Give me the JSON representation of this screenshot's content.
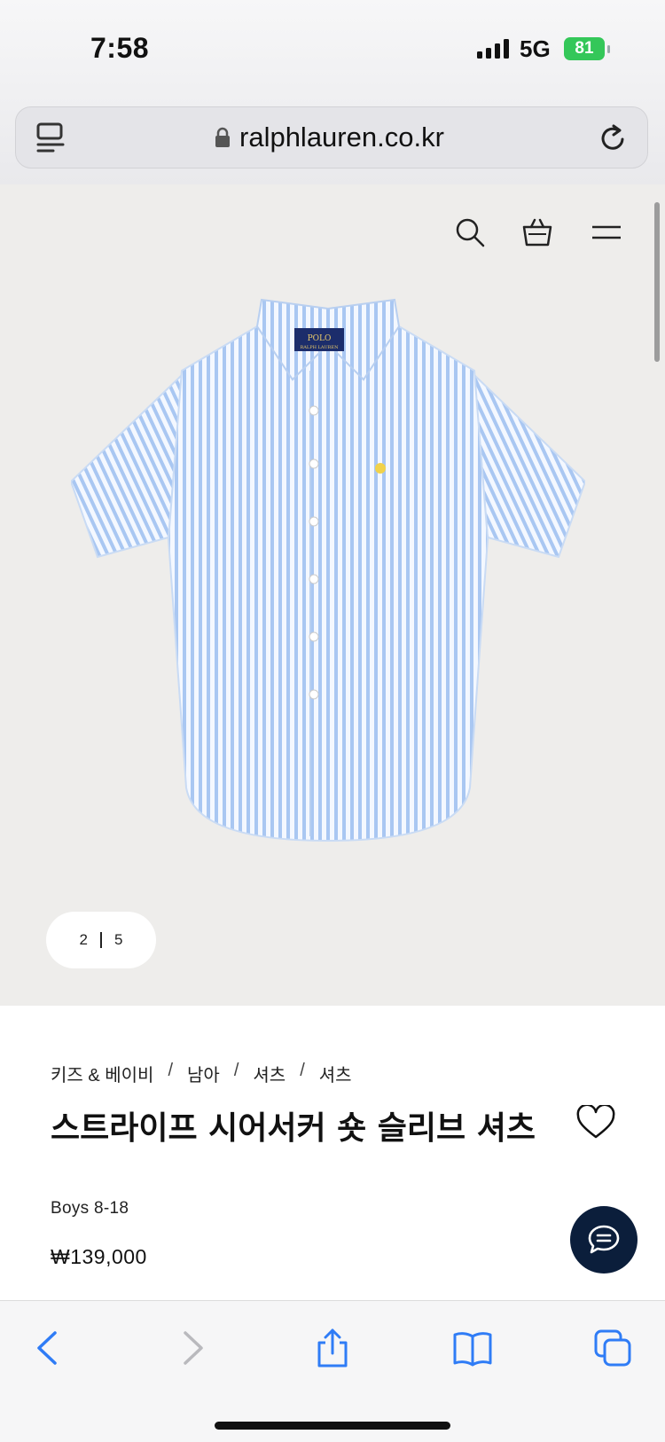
{
  "status_bar": {
    "time": "7:58",
    "network": "5G",
    "battery": "81"
  },
  "browser": {
    "url": "ralphlauren.co.kr"
  },
  "gallery": {
    "current": "2",
    "total": "5"
  },
  "product": {
    "breadcrumb": [
      "키즈 & 베이비",
      "남아",
      "셔츠",
      "셔츠"
    ],
    "title": "스트라이프 시어서커 숏 슬리브 셔츠",
    "subtitle": "Boys 8-18",
    "price": "₩139,000"
  },
  "colors": {
    "accent": "#2f7cf6",
    "chat": "#0b1e3b",
    "hero_bg": "#eeedeb",
    "battery": "#34c759"
  }
}
